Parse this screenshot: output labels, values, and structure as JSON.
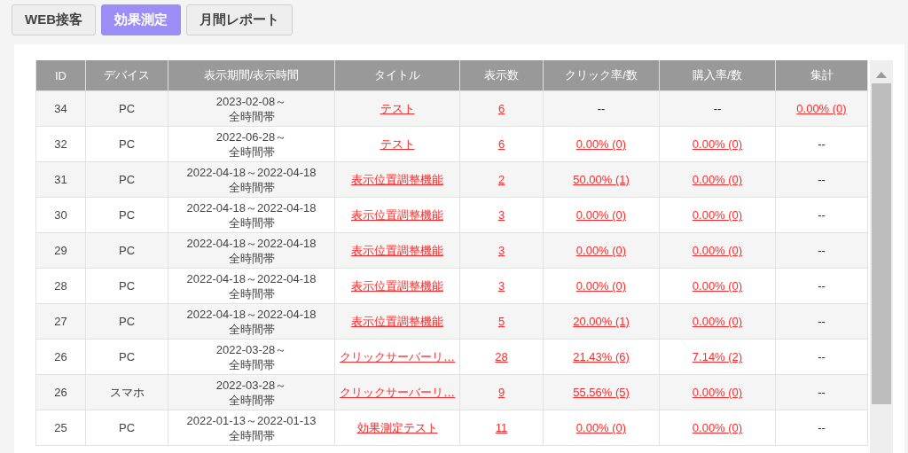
{
  "tabs": [
    {
      "label": "WEB接客",
      "selected": false
    },
    {
      "label": "効果測定",
      "selected": true
    },
    {
      "label": "月間レポート",
      "selected": false
    }
  ],
  "table": {
    "columns": [
      "ID",
      "デバイス",
      "表示期間/表示時間",
      "タイトル",
      "表示数",
      "クリック率/数",
      "購入率/数",
      "集計"
    ],
    "rows": [
      {
        "id": "34",
        "device": "PC",
        "period": "2023-02-08～",
        "hours": "全時間帯",
        "title": "テスト",
        "views": "6",
        "click": {
          "text": "--",
          "link": false
        },
        "purchase": {
          "text": "--",
          "link": false
        },
        "total": {
          "text": "0.00% (0)",
          "link": true
        }
      },
      {
        "id": "32",
        "device": "PC",
        "period": "2022-06-28～",
        "hours": "全時間帯",
        "title": "テスト",
        "views": "6",
        "click": {
          "text": "0.00% (0)",
          "link": true
        },
        "purchase": {
          "text": "0.00% (0)",
          "link": true
        },
        "total": {
          "text": "--",
          "link": false
        }
      },
      {
        "id": "31",
        "device": "PC",
        "period": "2022-04-18～2022-04-18",
        "hours": "全時間帯",
        "title": "表示位置調整機能",
        "views": "2",
        "click": {
          "text": "50.00% (1)",
          "link": true
        },
        "purchase": {
          "text": "0.00% (0)",
          "link": true
        },
        "total": {
          "text": "--",
          "link": false
        }
      },
      {
        "id": "30",
        "device": "PC",
        "period": "2022-04-18～2022-04-18",
        "hours": "全時間帯",
        "title": "表示位置調整機能",
        "views": "3",
        "click": {
          "text": "0.00% (0)",
          "link": true
        },
        "purchase": {
          "text": "0.00% (0)",
          "link": true
        },
        "total": {
          "text": "--",
          "link": false
        }
      },
      {
        "id": "29",
        "device": "PC",
        "period": "2022-04-18～2022-04-18",
        "hours": "全時間帯",
        "title": "表示位置調整機能",
        "views": "3",
        "click": {
          "text": "0.00% (0)",
          "link": true
        },
        "purchase": {
          "text": "0.00% (0)",
          "link": true
        },
        "total": {
          "text": "--",
          "link": false
        }
      },
      {
        "id": "28",
        "device": "PC",
        "period": "2022-04-18～2022-04-18",
        "hours": "全時間帯",
        "title": "表示位置調整機能",
        "views": "3",
        "click": {
          "text": "0.00% (0)",
          "link": true
        },
        "purchase": {
          "text": "0.00% (0)",
          "link": true
        },
        "total": {
          "text": "--",
          "link": false
        }
      },
      {
        "id": "27",
        "device": "PC",
        "period": "2022-04-18～2022-04-18",
        "hours": "全時間帯",
        "title": "表示位置調整機能",
        "views": "5",
        "click": {
          "text": "20.00% (1)",
          "link": true
        },
        "purchase": {
          "text": "0.00% (0)",
          "link": true
        },
        "total": {
          "text": "--",
          "link": false
        }
      },
      {
        "id": "26",
        "device": "PC",
        "period": "2022-03-28～",
        "hours": "全時間帯",
        "title": "クリックサーバーリ…",
        "views": "28",
        "click": {
          "text": "21.43% (6)",
          "link": true
        },
        "purchase": {
          "text": "7.14% (2)",
          "link": true
        },
        "total": {
          "text": "--",
          "link": false
        }
      },
      {
        "id": "26",
        "device": "スマホ",
        "period": "2022-03-28～",
        "hours": "全時間帯",
        "title": "クリックサーバーリ…",
        "views": "9",
        "click": {
          "text": "55.56% (5)",
          "link": true
        },
        "purchase": {
          "text": "0.00% (0)",
          "link": true
        },
        "total": {
          "text": "--",
          "link": false
        }
      },
      {
        "id": "25",
        "device": "PC",
        "period": "2022-01-13～2022-01-13",
        "hours": "全時間帯",
        "title": "効果測定テスト",
        "views": "11",
        "click": {
          "text": "0.00% (0)",
          "link": true
        },
        "purchase": {
          "text": "0.00% (0)",
          "link": true
        },
        "total": {
          "text": "--",
          "link": false
        }
      }
    ]
  }
}
